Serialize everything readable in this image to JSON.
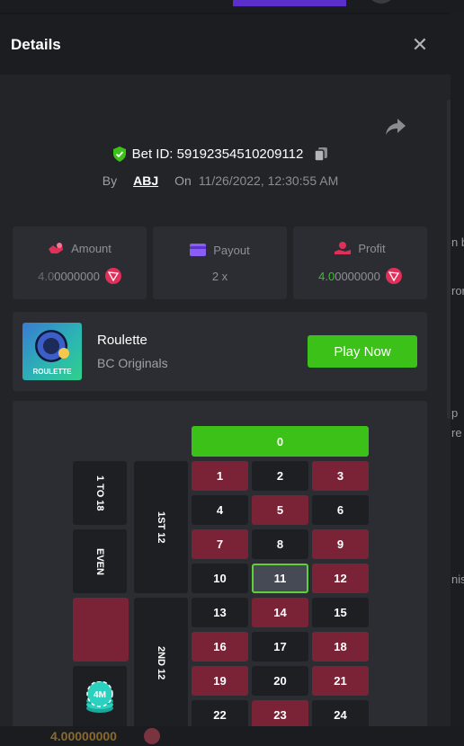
{
  "modal": {
    "title": "Details",
    "bet_id_label": "Bet ID: 59192354510209112",
    "by_label": "By",
    "user": "ABJ",
    "on_label": "On",
    "date": "11/26/2022, 12:30:55 AM"
  },
  "stats": {
    "amount": {
      "label": "Amount",
      "value_dim": "4.0",
      "value_rest": "0000000"
    },
    "payout": {
      "label": "Payout",
      "value": "2 x"
    },
    "profit": {
      "label": "Profit",
      "value_green": "4.0",
      "value_rest": "0000000"
    }
  },
  "game": {
    "name": "Roulette",
    "provider": "BC Originals",
    "thumb_label": "ROULETTE",
    "play_label": "Play Now"
  },
  "roulette": {
    "zero": "0",
    "side_labels": [
      "1 TO 18",
      "EVEN"
    ],
    "dozen_labels": [
      "1ST 12",
      "2ND 12"
    ],
    "chip_label": "4M",
    "selected": "11",
    "rows": [
      [
        {
          "n": "1",
          "c": "red"
        },
        {
          "n": "2",
          "c": "black"
        },
        {
          "n": "3",
          "c": "red"
        }
      ],
      [
        {
          "n": "4",
          "c": "black"
        },
        {
          "n": "5",
          "c": "red"
        },
        {
          "n": "6",
          "c": "black"
        }
      ],
      [
        {
          "n": "7",
          "c": "red"
        },
        {
          "n": "8",
          "c": "black"
        },
        {
          "n": "9",
          "c": "red"
        }
      ],
      [
        {
          "n": "10",
          "c": "black"
        },
        {
          "n": "11",
          "c": "black"
        },
        {
          "n": "12",
          "c": "red"
        }
      ],
      [
        {
          "n": "13",
          "c": "black"
        },
        {
          "n": "14",
          "c": "red"
        },
        {
          "n": "15",
          "c": "black"
        }
      ],
      [
        {
          "n": "16",
          "c": "red"
        },
        {
          "n": "17",
          "c": "black"
        },
        {
          "n": "18",
          "c": "red"
        }
      ],
      [
        {
          "n": "19",
          "c": "red"
        },
        {
          "n": "20",
          "c": "black"
        },
        {
          "n": "21",
          "c": "red"
        }
      ],
      [
        {
          "n": "22",
          "c": "black"
        },
        {
          "n": "23",
          "c": "red"
        },
        {
          "n": "24",
          "c": "black"
        }
      ]
    ]
  },
  "background": {
    "fragments": [
      "n b",
      "ror",
      "p",
      "re",
      "nis"
    ],
    "bottom_amount": "4.00000000"
  },
  "colors": {
    "red": "#7a2337",
    "green": "#3bc117",
    "accent": "#5fd038"
  }
}
